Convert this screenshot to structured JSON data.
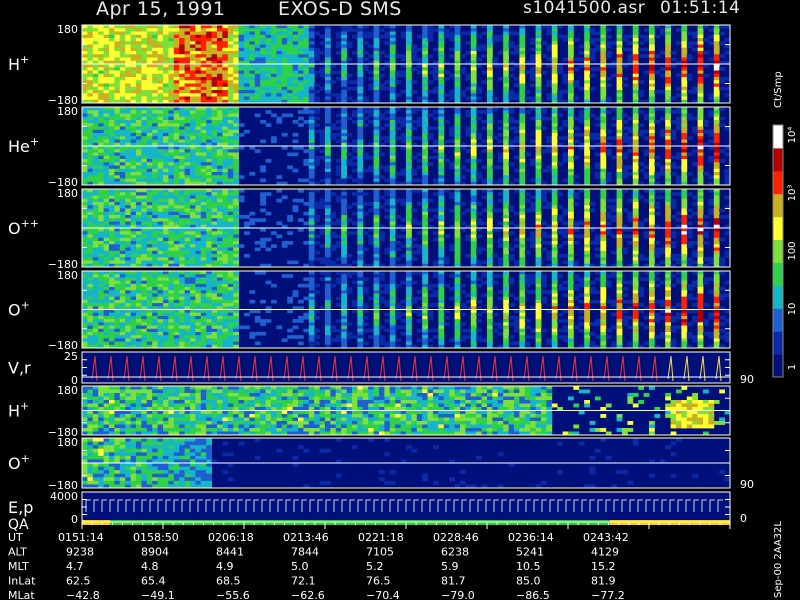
{
  "header": {
    "date": "Apr 15, 1991",
    "instrument": "EXOS-D SMS",
    "file": "s1041500.asr",
    "time": "01:51:14"
  },
  "colorbar": {
    "unit": "Ct/Smp",
    "ticks": [
      "1",
      "10",
      "100",
      "10³",
      "10⁴"
    ],
    "colors": [
      "#00107a",
      "#0a2aa8",
      "#1f5fd0",
      "#17b5c8",
      "#2fd04a",
      "#7ee03a",
      "#ffff30",
      "#c8b020",
      "#ff2000",
      "#b00000",
      "#ffffff"
    ]
  },
  "chart_data": [
    {
      "type": "heatmap",
      "name": "H+",
      "ytop": "180",
      "ybot": "−180",
      "ylim": [
        -180,
        180
      ],
      "ylabel": "H",
      "ylabel_sup": "+",
      "intensity_trend": "bright early (0151–0206 UT) and strong pitch-angle stripes throughout"
    },
    {
      "type": "heatmap",
      "name": "He+",
      "ytop": "180",
      "ybot": "−180",
      "ylim": [
        -180,
        180
      ],
      "ylabel": "He",
      "ylabel_sup": "+",
      "intensity_trend": "moderate early, gap 0206–0213 UT, stripes intensifying to red after 0240 UT"
    },
    {
      "type": "heatmap",
      "name": "O++",
      "ytop": "180",
      "ybot": "−180",
      "ylim": [
        -180,
        180
      ],
      "ylabel": "O",
      "ylabel_sup": "++",
      "intensity_trend": "weak early, stripes increasing toward end"
    },
    {
      "type": "heatmap",
      "name": "O+",
      "ytop": "180",
      "ybot": "−180",
      "ylim": [
        -180,
        180
      ],
      "ylabel": "O",
      "ylabel_sup": "+",
      "intensity_trend": "weak early, stripes increasing toward end"
    },
    {
      "type": "line",
      "name": "V,r",
      "ytop": "25",
      "ybot": "0",
      "ylim": [
        0,
        25
      ],
      "ylabel": "V,r",
      "right_tick": "90"
    },
    {
      "type": "heatmap",
      "name": "H+ (2)",
      "ytop": "180",
      "ybot": "−180",
      "ylim": [
        -180,
        180
      ],
      "ylabel": "H",
      "ylabel_sup": "+"
    },
    {
      "type": "heatmap",
      "name": "O+ (2)",
      "ytop": "180",
      "ybot": "−180",
      "ylim": [
        -180,
        180
      ],
      "ylabel": "O",
      "ylabel_sup": "+",
      "right_tick": "90"
    },
    {
      "type": "line",
      "name": "E,p / QA",
      "ytop": "4000",
      "ybot": "0",
      "ylim": [
        0,
        4000
      ],
      "ylabel": "E,p",
      "ylabel2": "QA",
      "right_tick": "0"
    }
  ],
  "time_axis": {
    "labels": [
      "UT",
      "ALT",
      "MLT",
      "InLat",
      "MLat"
    ],
    "columns": [
      {
        "UT": "0151:14",
        "ALT": "9238",
        "MLT": "4.7",
        "InLat": "62.5",
        "MLat": "−42.8"
      },
      {
        "UT": "0158:50",
        "ALT": "8904",
        "MLT": "4.8",
        "InLat": "65.4",
        "MLat": "−49.1"
      },
      {
        "UT": "0206:18",
        "ALT": "8441",
        "MLT": "4.9",
        "InLat": "68.5",
        "MLat": "−55.6"
      },
      {
        "UT": "0213:46",
        "ALT": "7844",
        "MLT": "5.0",
        "InLat": "72.1",
        "MLat": "−62.6"
      },
      {
        "UT": "0221:18",
        "ALT": "7105",
        "MLT": "5.2",
        "InLat": "76.5",
        "MLat": "−70.4"
      },
      {
        "UT": "0228:46",
        "ALT": "6238",
        "MLT": "5.9",
        "InLat": "81.7",
        "MLat": "−79.0"
      },
      {
        "UT": "0236:14",
        "ALT": "5241",
        "MLT": "10.5",
        "InLat": "85.0",
        "MLat": "−86.5"
      },
      {
        "UT": "0243:42",
        "ALT": "4129",
        "MLT": "15.2",
        "InLat": "81.9",
        "MLat": "−77.2"
      }
    ]
  },
  "footer_note": "Sep-00 2AA32L"
}
